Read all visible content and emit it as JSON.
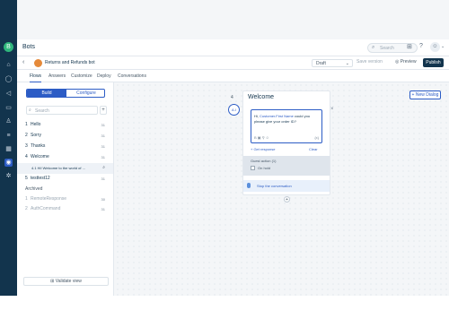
{
  "app": {
    "title": "Bots"
  },
  "rail": {
    "logo": "B",
    "icons": [
      "home-icon",
      "chat-icon",
      "megaphone-icon",
      "book-icon",
      "contacts-icon",
      "list-icon",
      "reports-icon",
      "bot-icon",
      "settings-icon"
    ]
  },
  "topbar": {
    "search_placeholder": "Search"
  },
  "subbar": {
    "bot_name": "Returns and Refunds bot",
    "status": "Draft",
    "save_label": "Save version",
    "preview_label": "Preview",
    "publish_label": "Publish"
  },
  "tabs": [
    {
      "label": "Flows",
      "active": true
    },
    {
      "label": "Answers"
    },
    {
      "label": "Customize"
    },
    {
      "label": "Deploy"
    },
    {
      "label": "Conversations"
    }
  ],
  "left": {
    "build_label": "Build",
    "configure_label": "Configure",
    "search_placeholder": "Search",
    "flows": [
      {
        "num": "1",
        "name": "Hello",
        "count": "31"
      },
      {
        "num": "2",
        "name": "Sorry",
        "count": "31"
      },
      {
        "num": "3",
        "name": "Thanks",
        "count": "31"
      },
      {
        "num": "4",
        "name": "Welcome",
        "count": "31"
      },
      {
        "num": "5",
        "name": "testtest12",
        "count": "31"
      }
    ],
    "sub_item": "4.1  Hi! Welcome to the world of ...",
    "archived_label": "Archived",
    "archived": [
      {
        "num": "1",
        "name": "RemoteResponse",
        "count": "30"
      },
      {
        "num": "2",
        "name": "AuthCommand",
        "count": "31"
      }
    ],
    "validate_label": "Validate view"
  },
  "canvas": {
    "new_dialog_label": "+ New Dialog",
    "card_number": "4",
    "card_title": "Welcome",
    "bot_avatar": "A.I",
    "message_prefix": "Hi,",
    "message_highlight": "Customer.First Name",
    "message_suffix": "could you please give your order ID?",
    "get_response": "+ Get response",
    "clear": "Clear",
    "guest_label": "Guest action (1)",
    "guest_option": "On hold",
    "stop_label": "Stop the conversation"
  }
}
